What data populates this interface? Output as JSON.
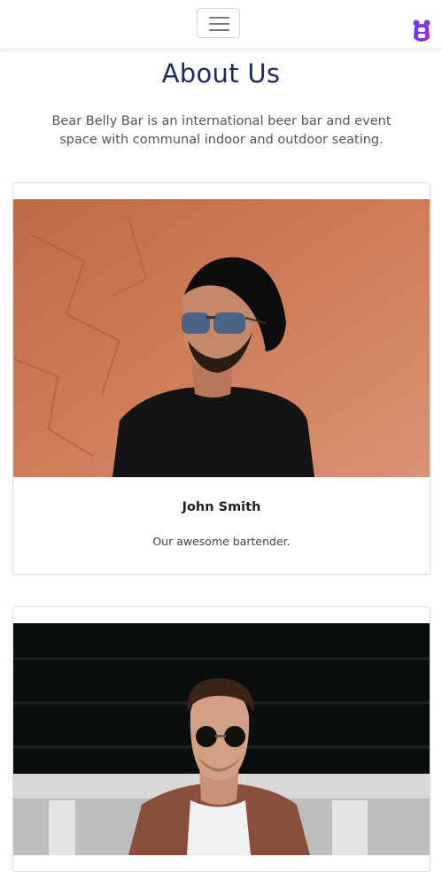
{
  "navbar": {
    "menu_icon": "hamburger-menu-icon",
    "logo_icon": "bear-logo-icon",
    "logo_color": "#8a2be2"
  },
  "about": {
    "title": "About Us",
    "description": "Bear Belly Bar is an international beer bar and event space with communal indoor and outdoor seating."
  },
  "team": [
    {
      "name": "John Smith",
      "role": "Our awesome bartender."
    },
    {
      "name": "",
      "role": ""
    }
  ],
  "colors": {
    "title": "#1e2b5c",
    "text": "#555555",
    "card_border": "#dedede"
  }
}
